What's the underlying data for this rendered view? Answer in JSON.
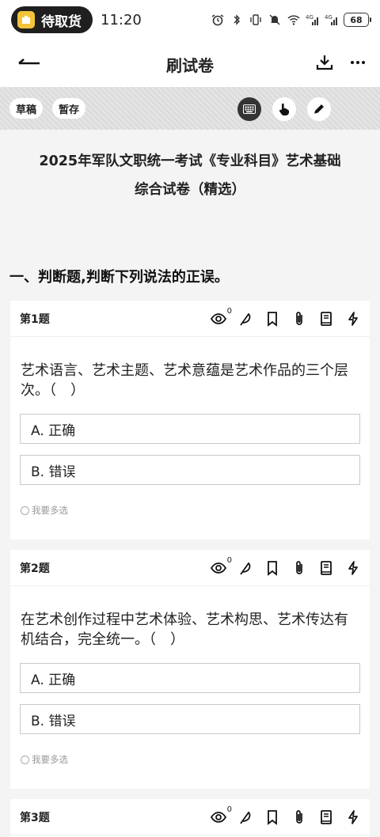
{
  "status_bar": {
    "pill_label": "待取货",
    "time": "11:20",
    "signal_1": "4G",
    "signal_2": "4G",
    "battery": "68"
  },
  "nav": {
    "title": "刷试卷"
  },
  "toolbar": {
    "draft_label": "草稿",
    "save_label": "暂存"
  },
  "exam": {
    "title_line1": "2025年军队文职统一考试《专业科目》艺术基础",
    "title_line2": "综合试卷（精选）",
    "section_title": "一、判断题,判断下列说法的正误。"
  },
  "questions": [
    {
      "number": "第1题",
      "eye_count": "0",
      "text": "艺术语言、艺术主题、艺术意蕴是艺术作品的三个层次。（　）",
      "options": [
        "A.  正确",
        "B.  错误"
      ],
      "multi_label": "我要多选"
    },
    {
      "number": "第2题",
      "eye_count": "0",
      "text": "在艺术创作过程中艺术体验、艺术构思、艺术传达有机结合，完全统一。（　）",
      "options": [
        "A.  正确",
        "B.  错误"
      ],
      "multi_label": "我要多选"
    },
    {
      "number": "第3题",
      "eye_count": "0"
    }
  ],
  "colors": {
    "accent_dark": "#333333",
    "pill_bg": "#1f1f1f",
    "pill_icon": "#f3c43b",
    "page_bg": "#f4f4f4"
  }
}
